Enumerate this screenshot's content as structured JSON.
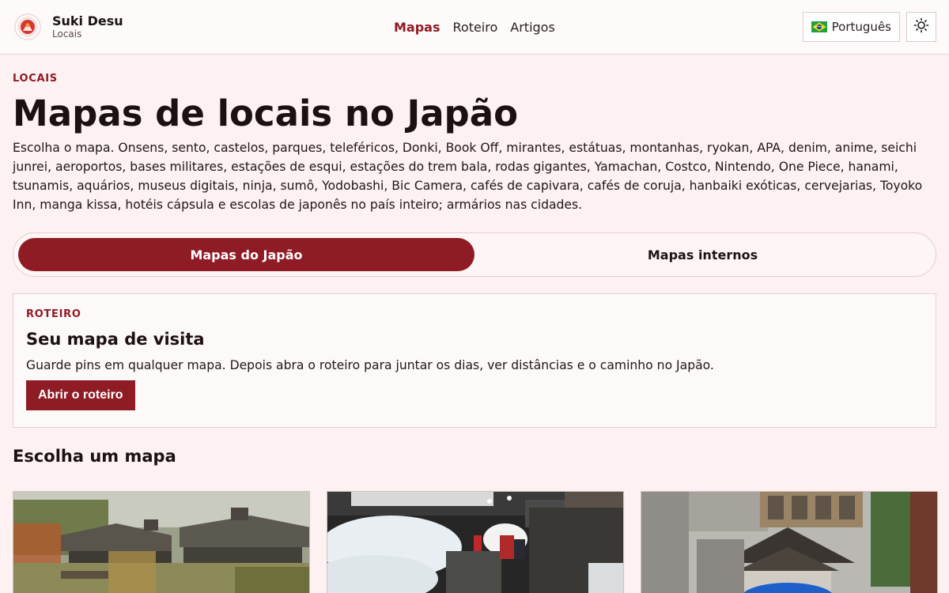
{
  "header": {
    "brand_name": "Suki Desu",
    "brand_sub": "Locais",
    "nav": [
      {
        "label": "Mapas",
        "active": true
      },
      {
        "label": "Roteiro",
        "active": false
      },
      {
        "label": "Artigos",
        "active": false
      }
    ],
    "language": "Português",
    "language_flag_icon": "brazil-flag-icon",
    "theme_icon": "sun-icon"
  },
  "main": {
    "eyebrow": "LOCAIS",
    "title": "Mapas de locais no Japão",
    "intro": "Escolha o mapa. Onsens, sento, castelos, parques, teleféricos, Donki, Book Off, mirantes, estátuas, montanhas, ryokan, APA, denim, anime, seichi junrei, aeroportos, bases militares, estações de esqui, estações do trem bala, rodas gigantes, Yamachan, Costco, Nintendo, One Piece, hanami, tsunamis, aquários, museus digitais, ninja, sumô, Yodobashi, Bic Camera, cafés de capivara, cafés de coruja, hanbaiki exóticas, cervejarias, Toyoko Inn, manga kissa, hotéis cápsula e escolas de japonês no país inteiro; armários nas cidades.",
    "tabs": [
      {
        "label": "Mapas do Japão",
        "active": true
      },
      {
        "label": "Mapas internos",
        "active": false
      }
    ],
    "card": {
      "eyebrow": "ROTEIRO",
      "title": "Seu mapa de visita",
      "text": "Guarde pins em qualquer mapa. Depois abra o roteiro para juntar os dias, ver distâncias e o caminho no Japão.",
      "button": "Abrir o roteiro"
    },
    "section_title": "Escolha um mapa"
  },
  "colors": {
    "accent": "#8f1b24",
    "background": "#fdf1f1"
  }
}
